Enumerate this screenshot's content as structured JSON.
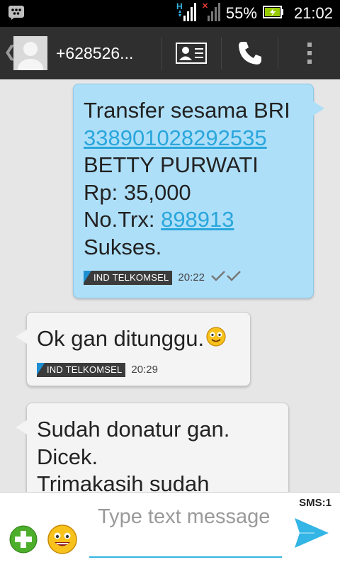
{
  "status_bar": {
    "battery_percent": "55%",
    "time": "21:02",
    "network_type": "H",
    "signal_icon": "signal-bars-icon",
    "battery_icon": "battery-charging-icon",
    "notification_icon": "bbm-notification-icon"
  },
  "header": {
    "contact": "+628526...",
    "contact_card_icon": "contact-card-icon",
    "call_icon": "phone-icon",
    "menu_icon": "overflow-menu-icon"
  },
  "messages": [
    {
      "direction": "sent",
      "lines": [
        "Transfer sesama BRI",
        "338901028292535",
        "BETTY PURWATI",
        "Rp: 35,000",
        "No.Trx: ",
        "898913",
        "Sukses."
      ],
      "carrier": "IND TELKOMSEL",
      "time": "20:22",
      "status_icon": "double-check-icon"
    },
    {
      "direction": "received",
      "text": "Ok gan ditunggu.",
      "emoji_icon": "smiley-icon",
      "carrier": "IND TELKOMSEL",
      "time": "20:29"
    },
    {
      "direction": "received",
      "lines": [
        "Sudah donatur gan.",
        "Dicek.",
        "Trimakasih sudah"
      ]
    }
  ],
  "composer": {
    "placeholder": "Type text message",
    "counter": "SMS:1",
    "add_icon": "add-attachment-icon",
    "emoji_icon": "smiley-icon",
    "send_icon": "send-icon"
  },
  "colors": {
    "sent_bubble": "#aedff9",
    "received_bubble": "#f4f4f4",
    "link": "#2aa6dc",
    "accent": "#33b5e5"
  }
}
